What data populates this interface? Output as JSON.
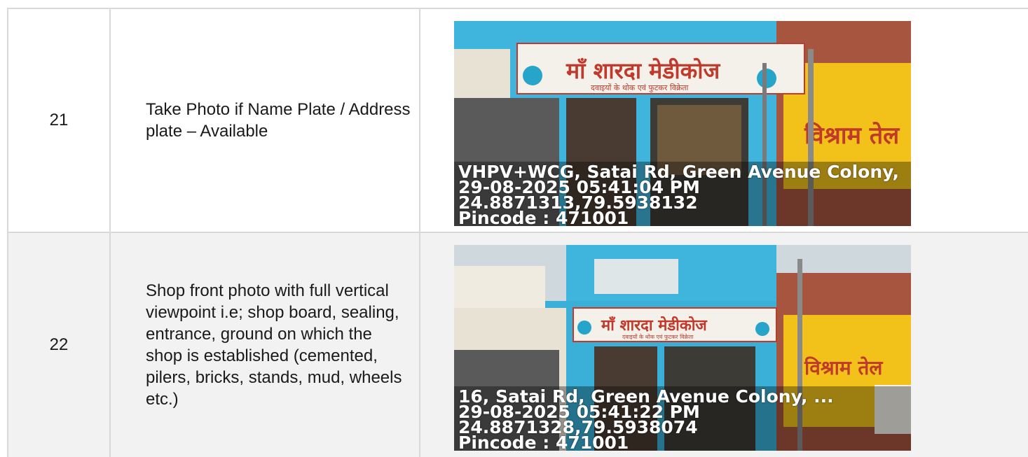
{
  "rows": [
    {
      "number": "21",
      "description": "Take Photo if Name Plate / Address plate – Available",
      "photo": {
        "sign_title": "माँ शारदा मेडीकोज",
        "sign_subtitle": "दवाइयों के थोक एवं फुटकर विक्रेता",
        "wall_text": "विश्राम तेल",
        "overlay": {
          "address": "VHPV+WCG, Satai Rd, Green Avenue Colony,",
          "datetime": "29-08-2025 05:41:04 PM",
          "coords": "24.8871313,79.5938132",
          "pincode": "Pincode : 471001"
        }
      }
    },
    {
      "number": "22",
      "description": "Shop front photo with full vertical viewpoint i.e; shop board, sealing, entrance, ground on which the shop is established (cemented, pilers, bricks, stands, mud, wheels etc.)",
      "photo": {
        "sign_title": "माँ शारदा मेडीकोज",
        "sign_subtitle": "दवाइयों के थोक एवं फुटकर विक्रेता",
        "wall_text": "विश्राम तेल",
        "overlay": {
          "address": "16, Satai Rd, Green Avenue Colony, ...",
          "datetime": "29-08-2025 05:41:22 PM",
          "coords": "24.8871328,79.5938074",
          "pincode": "Pincode : 471001"
        }
      }
    }
  ],
  "colors": {
    "border": "#d9d9d9",
    "row_alt": "#f2f2f2",
    "wall_blue": "#3ab0d8",
    "wall_yellow": "#f2c21b",
    "sign_red": "#c0392b"
  }
}
